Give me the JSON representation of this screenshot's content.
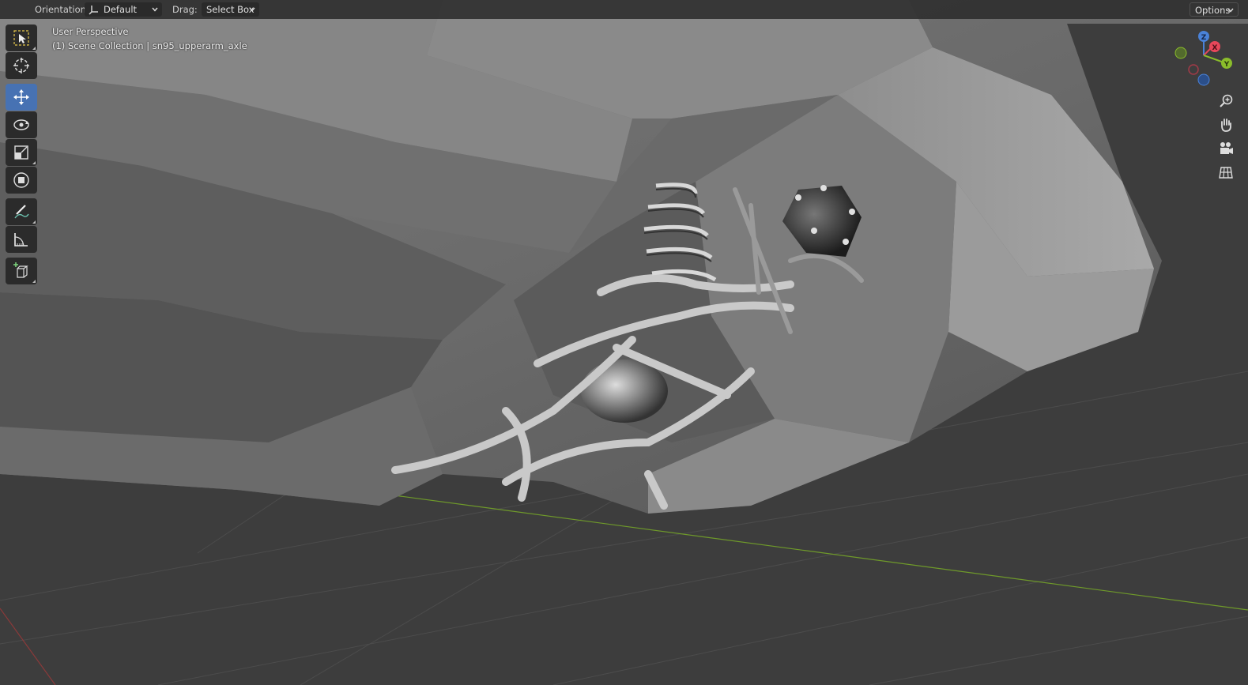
{
  "header": {
    "orientation_label": "Orientation:",
    "orientation_value": "Default",
    "drag_label": "Drag:",
    "drag_value": "Select Box",
    "options_label": "Options"
  },
  "viewport": {
    "view_name": "User Perspective",
    "collection_info": "(1) Scene Collection | sn95_upperarm_axle"
  },
  "toolbar": {
    "tools": [
      {
        "name": "select-box-icon",
        "active": false
      },
      {
        "name": "cursor-icon",
        "active": false
      },
      {
        "name": "move-icon",
        "active": true
      },
      {
        "name": "rotate-icon",
        "active": false
      },
      {
        "name": "scale-icon",
        "active": false
      },
      {
        "name": "transform-icon",
        "active": false
      },
      {
        "name": "annotate-icon",
        "active": false
      },
      {
        "name": "measure-icon",
        "active": false
      },
      {
        "name": "add-cube-icon",
        "active": false
      }
    ]
  },
  "gizmo": {
    "axes": {
      "x": "X",
      "y": "Y",
      "z": "Z"
    },
    "colors": {
      "x": "#e8475a",
      "y": "#8bbd2b",
      "z": "#4a82d8"
    }
  },
  "nav_buttons": [
    "zoom-icon",
    "hand-pan-icon",
    "camera-icon",
    "grid-view-icon"
  ],
  "colors": {
    "background": "#3d3d3d",
    "header": "#303030",
    "active_tool": "#4772b3",
    "x_axis_line": "#8a3a3a",
    "y_axis_line": "#6f9a2a"
  }
}
